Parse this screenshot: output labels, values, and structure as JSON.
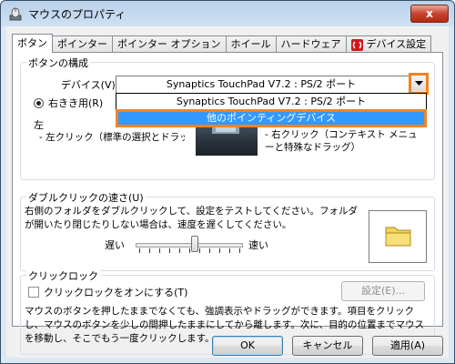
{
  "window": {
    "title": "マウスのプロパティ",
    "close_label": "x"
  },
  "tabs": [
    {
      "label": "ボタン",
      "active": true
    },
    {
      "label": "ポインター"
    },
    {
      "label": "ポインター オプション"
    },
    {
      "label": "ホイール"
    },
    {
      "label": "ハードウェア"
    },
    {
      "label": "デバイス設定"
    }
  ],
  "button_config": {
    "group_title": "ボタンの構成",
    "device_label": "デバイス(V):",
    "device_selected": "Synaptics TouchPad V7.2 : PS/2 ポート",
    "dropdown_options": [
      "Synaptics TouchPad V7.2 : PS/2 ポート",
      "他のポインティングデバイス"
    ],
    "right_hand_label": "右きき用(R)",
    "left_label": "左",
    "left_click_desc": "- 左クリック（標準の選択とドラッグ）",
    "right_click_desc": "- 右クリック（コンテキスト メニューと特殊なドラッグ）"
  },
  "double_click": {
    "group_title": "ダブルクリックの速さ(U)",
    "description": "右側のフォルダをダブルクリックして、設定をテストしてください。フォルダが開いたり閉じたりしない場合は、速度を遅くしてください。",
    "slow_label": "遅い",
    "fast_label": "速い",
    "speed_fraction": 0.55
  },
  "click_lock": {
    "group_title": "クリックロック",
    "checkbox_label": "クリックロックをオンにする(T)",
    "settings_button": "設定(E)...",
    "description": "マウスのボタンを押したままでなくても、強調表示やドラッグができます。項目をクリックし、マウスのボタンを少しの間押したままにしてから離します。次に、目的の位置までマウスを移動し、そこでもう一度クリックします。"
  },
  "footer": {
    "ok": "OK",
    "cancel": "キャンセル",
    "apply": "適用(A)"
  }
}
